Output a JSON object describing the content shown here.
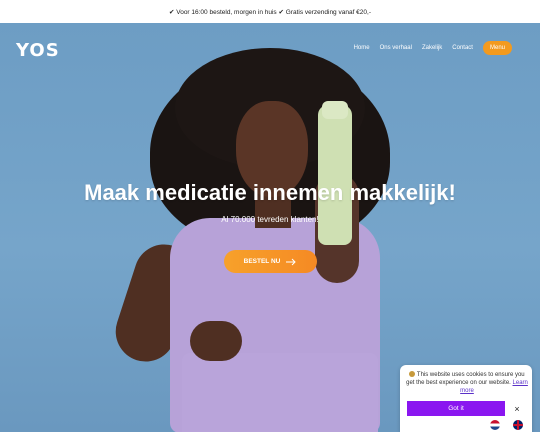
{
  "topbar": {
    "text": "✔ Voor 16:00 besteld, morgen in huis ✔ Gratis verzending vanaf €20,-"
  },
  "header": {
    "logo": "YOS",
    "nav": [
      "Home",
      "Ons verhaal",
      "Zakelijk",
      "Contact"
    ],
    "menu_label": "Menu"
  },
  "hero": {
    "headline": "Maak medicatie innemen makkelijk!",
    "subtitle": "Al 70.000 tevreden klanten!",
    "cta_label": "BESTEL NU",
    "cta_icon": "arrow-right-icon"
  },
  "cookie": {
    "text": "This website uses cookies to ensure you get the best experience on our website.",
    "learn_more": "Learn more",
    "accept_label": "Got it",
    "close_icon": "×"
  },
  "language": {
    "options": [
      "nl-flag-icon",
      "gb-flag-icon"
    ]
  },
  "colors": {
    "accent": "#f39a1e",
    "cookie_button": "#8a16f0"
  }
}
